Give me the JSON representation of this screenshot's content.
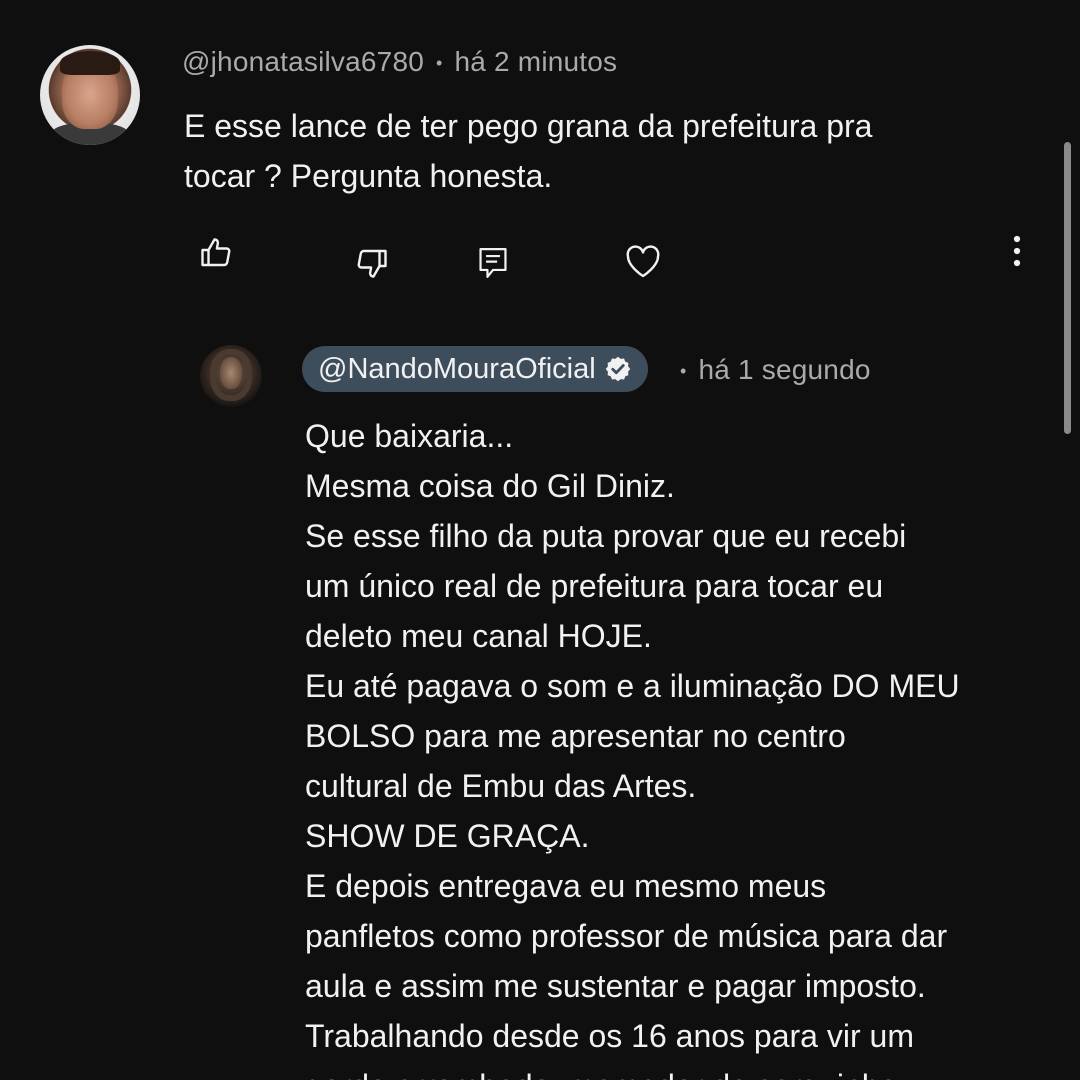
{
  "parent_comment": {
    "author": "@jhonatasilva6780",
    "time": "há 2 minutos",
    "lines": [
      "E esse lance de ter pego grana da prefeitura pra",
      "tocar ? Pergunta honesta."
    ]
  },
  "actions": {
    "like_icon": "thumbs-up-icon",
    "dislike_icon": "thumbs-down-icon",
    "reply_icon": "reply-icon",
    "heart_icon": "heart-icon",
    "more_icon": "more-vert-icon"
  },
  "reply_comment": {
    "author": "@NandoMouraOficial",
    "verified": true,
    "time": "há 1 segundo",
    "lines": [
      "Que baixaria...",
      "Mesma coisa do Gil Diniz.",
      "Se esse filho da puta provar que eu recebi",
      "um único real de prefeitura para tocar eu",
      "deleto meu canal HOJE.",
      "Eu até pagava o som e a iluminação DO MEU",
      "BOLSO para me apresentar no centro",
      "cultural de Embu das Artes.",
      "SHOW DE GRAÇA.",
      "E depois entregava eu mesmo meus",
      "panfletos como professor de música para dar",
      "aula e assim me sustentar e pagar imposto.",
      "Trabalhando desde os 16 anos para vir um",
      "gordo arrombado, mamador de sarquinho"
    ]
  },
  "colors": {
    "background": "#0f0f0f",
    "text": "#f1f1f1",
    "meta": "#aaaaaa",
    "author_pill": "#3e4d5c"
  }
}
